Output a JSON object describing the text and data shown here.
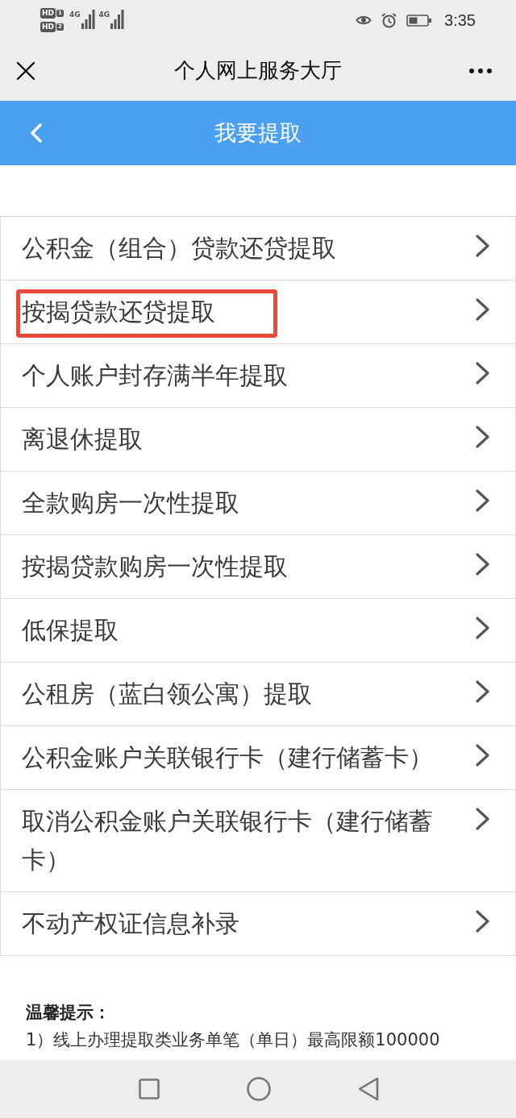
{
  "status_bar": {
    "sims": [
      {
        "badge": "HD",
        "slot": "1",
        "network": "4G"
      },
      {
        "badge": "HD",
        "slot": "2",
        "network": "4G"
      }
    ],
    "time": "3:35"
  },
  "title_bar": {
    "title": "个人网上服务大厅"
  },
  "header": {
    "title": "我要提取"
  },
  "items": [
    {
      "label": "公积金（组合）贷款还贷提取",
      "highlighted": false
    },
    {
      "label": "按揭贷款还贷提取",
      "highlighted": true
    },
    {
      "label": "个人账户封存满半年提取",
      "highlighted": false
    },
    {
      "label": "离退休提取",
      "highlighted": false
    },
    {
      "label": "全款购房一次性提取",
      "highlighted": false
    },
    {
      "label": "按揭贷款购房一次性提取",
      "highlighted": false
    },
    {
      "label": "低保提取",
      "highlighted": false
    },
    {
      "label": "公租房（蓝白领公寓）提取",
      "highlighted": false
    },
    {
      "label": "公积金账户关联银行卡（建行储蓄卡）",
      "highlighted": false
    },
    {
      "label": "取消公积金账户关联银行卡（建行储蓄卡）",
      "highlighted": false
    },
    {
      "label": "不动产权证信息补录",
      "highlighted": false
    }
  ],
  "notice": {
    "title": "温馨提示：",
    "lines": [
      "1）线上办理提取类业务单笔（单日）最高限额100000"
    ]
  }
}
